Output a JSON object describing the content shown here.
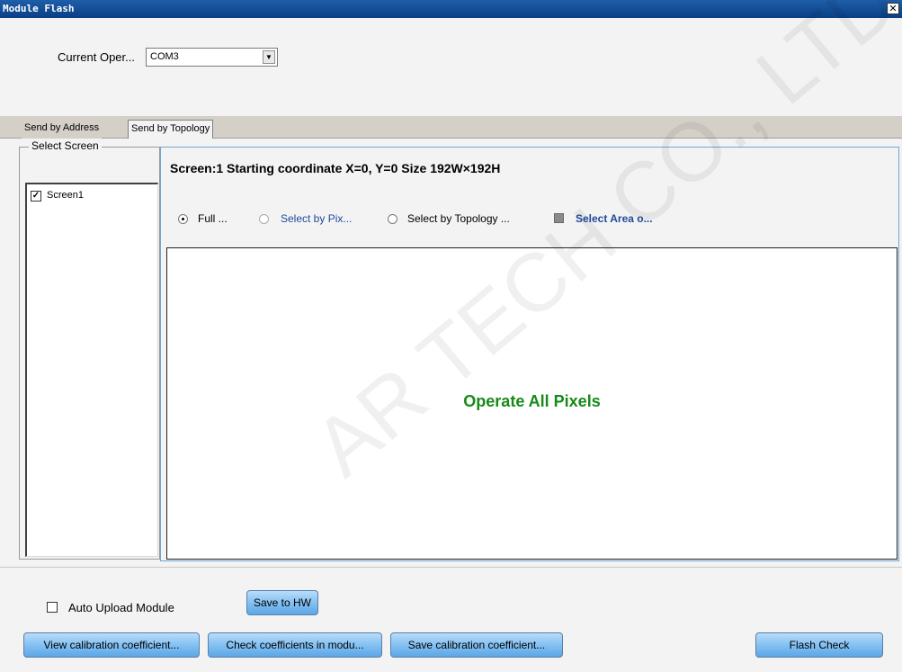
{
  "window": {
    "title": "Module Flash",
    "close_glyph": "✕"
  },
  "current_operation": {
    "label": "Current Oper...",
    "value": "COM3",
    "arrow": "▼"
  },
  "tabs": [
    {
      "label": "Send by Address"
    },
    {
      "label": "Send by Topology",
      "active": true
    }
  ],
  "select_screen": {
    "legend": "Select Screen",
    "screens": [
      {
        "label": "Screen1",
        "checked": true,
        "mark": "✓"
      }
    ]
  },
  "screen_info": "Screen:1  Starting coordinate X=0, Y=0   Size 192W×192H",
  "modes": {
    "full": "Full ...",
    "by_pixel": "Select by Pix...",
    "by_topology": "Select by Topology ...",
    "select_area": "Select Area o..."
  },
  "canvas_message": "Operate All Pixels",
  "auto_upload": {
    "label": "Auto Upload Module",
    "checked": false
  },
  "buttons": {
    "save_to_hw": "Save to HW",
    "view_calibration": "View calibration coefficient...",
    "check_coefficients": "Check coefficients in modu...",
    "save_calibration": "Save calibration coefficient...",
    "flash_check": "Flash Check"
  },
  "watermark_text": "AR TECH CO., LTD",
  "colors": {
    "titlebar": "#0b3f86",
    "message_green": "#178a17",
    "link_blue": "#1f4a9c",
    "button_blue": "#7fbef1"
  }
}
